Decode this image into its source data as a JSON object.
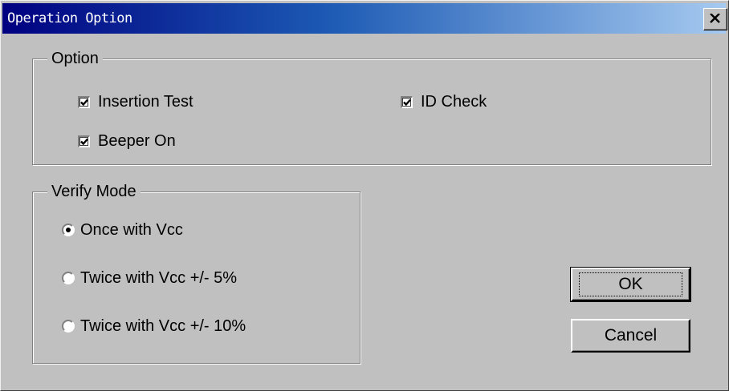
{
  "window": {
    "title": "Operation Option",
    "close_icon": "close-icon"
  },
  "option_group": {
    "legend": "Option",
    "insertion_test": {
      "label": "Insertion Test",
      "checked": true
    },
    "id_check": {
      "label": "ID Check",
      "checked": true
    },
    "beeper_on": {
      "label": "Beeper On",
      "checked": true
    }
  },
  "verify_group": {
    "legend": "Verify Mode",
    "options": [
      {
        "label": "Once with Vcc",
        "selected": true
      },
      {
        "label": "Twice with Vcc +/- 5%",
        "selected": false
      },
      {
        "label": "Twice with Vcc +/- 10%",
        "selected": false
      }
    ]
  },
  "buttons": {
    "ok": "OK",
    "cancel": "Cancel"
  },
  "colors": {
    "face": "#c0c0c0",
    "title_start": "#000080",
    "title_end": "#a6caf0"
  }
}
